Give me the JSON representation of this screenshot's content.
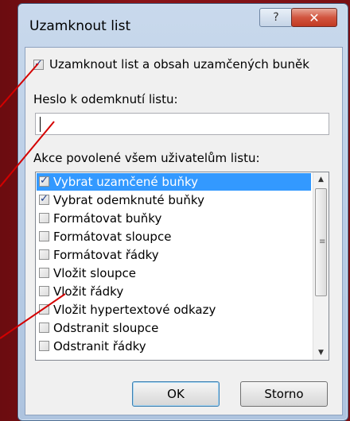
{
  "dialog": {
    "title": "Uzamknout list",
    "help_icon": "question-icon",
    "close_icon": "close-icon"
  },
  "lock_sheet": {
    "label": "Uzamknout list a obsah uzamčených buněk",
    "checked": true
  },
  "password": {
    "label": "Heslo k odemknutí listu:",
    "value": ""
  },
  "actions": {
    "label": "Akce povolené všem uživatelům listu:",
    "items": [
      {
        "label": "Vybrat uzamčené buňky",
        "checked": true,
        "selected": true
      },
      {
        "label": "Vybrat odemknuté buňky",
        "checked": true,
        "selected": false
      },
      {
        "label": "Formátovat buňky",
        "checked": false,
        "selected": false
      },
      {
        "label": "Formátovat sloupce",
        "checked": false,
        "selected": false
      },
      {
        "label": "Formátovat řádky",
        "checked": false,
        "selected": false
      },
      {
        "label": "Vložit sloupce",
        "checked": false,
        "selected": false
      },
      {
        "label": "Vložit řádky",
        "checked": false,
        "selected": false
      },
      {
        "label": "Vložit hypertextové odkazy",
        "checked": false,
        "selected": false
      },
      {
        "label": "Odstranit sloupce",
        "checked": false,
        "selected": false
      },
      {
        "label": "Odstranit řádky",
        "checked": false,
        "selected": false
      }
    ]
  },
  "buttons": {
    "ok": "OK",
    "cancel": "Storno"
  },
  "colors": {
    "background": "#7a0f14",
    "selection": "#3399ff",
    "annotation_line": "#d40000"
  }
}
